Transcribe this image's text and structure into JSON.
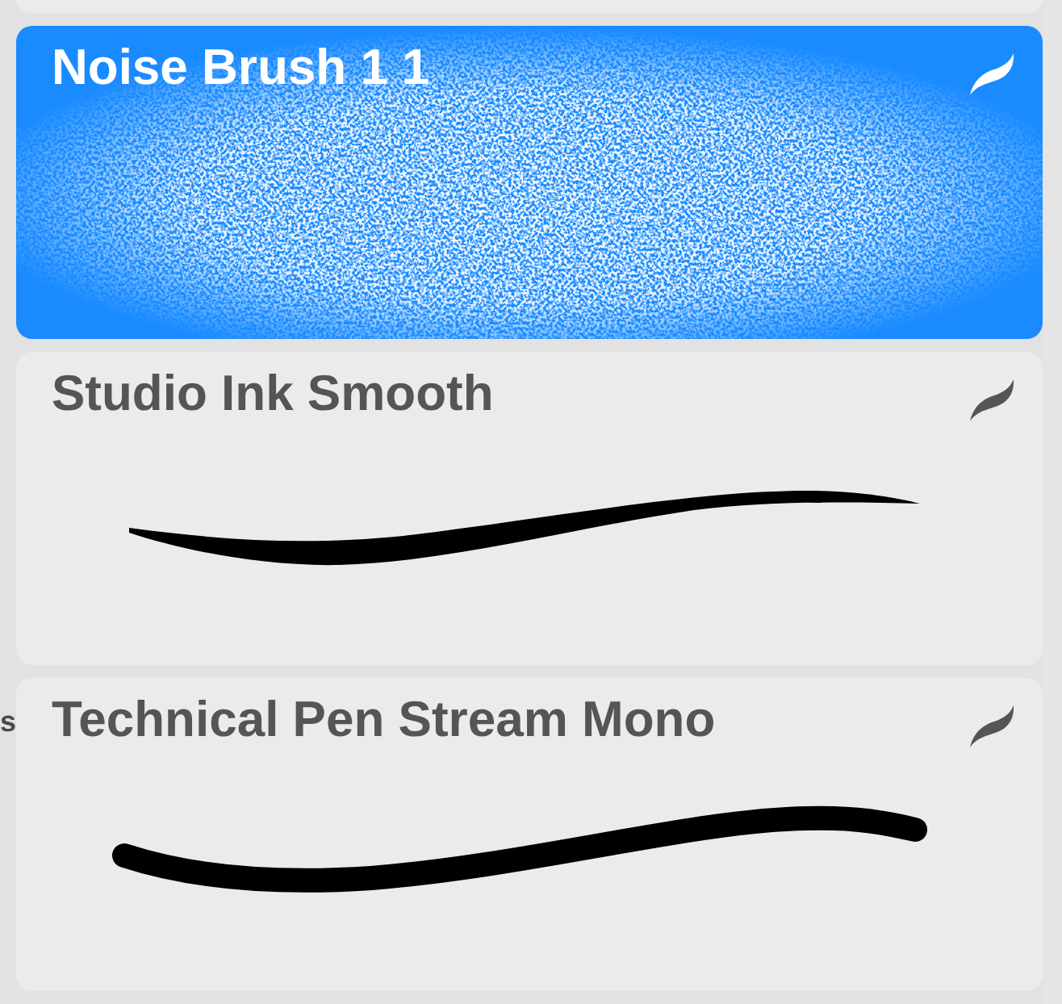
{
  "left_panel": {
    "label_fragment": "s"
  },
  "brushes": [
    {
      "name": "Noise Brush 1 1",
      "selected": true,
      "kind": "noise"
    },
    {
      "name": "Studio Ink Smooth",
      "selected": false,
      "kind": "ink"
    },
    {
      "name": "Technical Pen Stream Mono",
      "selected": false,
      "kind": "pen"
    }
  ]
}
